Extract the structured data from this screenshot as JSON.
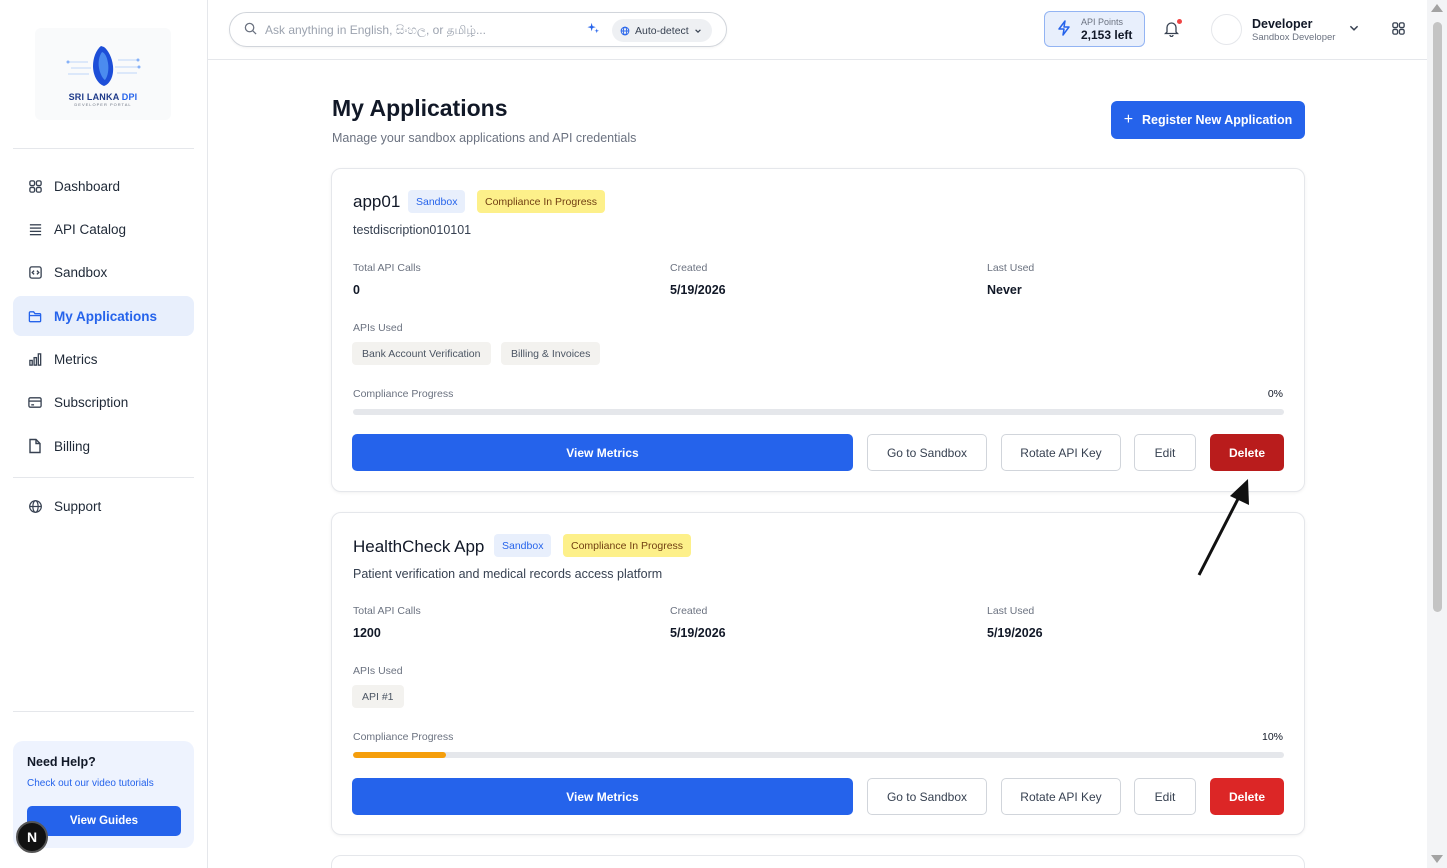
{
  "sidebar": {
    "logo": {
      "line1": "SRI LANKA",
      "line2": "DPI",
      "line3": "DEVELOPER PORTAL"
    },
    "items": [
      {
        "label": "Dashboard",
        "icon": "grid-icon"
      },
      {
        "label": "API Catalog",
        "icon": "list-icon"
      },
      {
        "label": "Sandbox",
        "icon": "code-icon"
      },
      {
        "label": "My Applications",
        "icon": "folder-icon",
        "active": true
      },
      {
        "label": "Metrics",
        "icon": "bar-chart-icon"
      },
      {
        "label": "Subscription",
        "icon": "credit-card-icon"
      },
      {
        "label": "Billing",
        "icon": "file-icon"
      },
      {
        "label": "Support",
        "icon": "globe-icon"
      }
    ],
    "help": {
      "title": "Need Help?",
      "subtitle": "Check out our video tutorials",
      "button": "View Guides"
    },
    "badge": "N"
  },
  "topbar": {
    "search_placeholder": "Ask anything in English, සිංහල, or தமிழ்...",
    "language": "Auto-detect",
    "points": {
      "label": "API Points",
      "value": "2,153 left"
    },
    "user": {
      "name": "Developer",
      "role": "Sandbox Developer"
    }
  },
  "main": {
    "title": "My Applications",
    "subtitle": "Manage your sandbox applications and API credentials",
    "register_button": "Register New Application"
  },
  "labels": {
    "total_calls": "Total API Calls",
    "created": "Created",
    "last_used": "Last Used",
    "apis_used": "APIs Used",
    "compliance": "Compliance Progress",
    "view_metrics": "View Metrics",
    "go_sandbox": "Go to Sandbox",
    "rotate_key": "Rotate API Key",
    "edit": "Edit",
    "delete": "Delete"
  },
  "apps": [
    {
      "name": "app01",
      "env": "Sandbox",
      "status": "Compliance In Progress",
      "description": "testdiscription010101",
      "total_calls": "0",
      "created": "5/19/2026",
      "last_used": "Never",
      "apis": [
        "Bank Account Verification",
        "Billing & Invoices"
      ],
      "progress_text": "0%",
      "progress": 0
    },
    {
      "name": "HealthCheck App",
      "env": "Sandbox",
      "status": "Compliance In Progress",
      "description": "Patient verification and medical records access platform",
      "total_calls": "1200",
      "created": "5/19/2026",
      "last_used": "5/19/2026",
      "apis": [
        "API #1"
      ],
      "progress_text": "10%",
      "progress": 0.1
    }
  ],
  "colors": {
    "primary": "#2563eb",
    "danger": "#dc2626",
    "progress": "#f59e0b",
    "badge_yellow": "#fdf08a"
  }
}
